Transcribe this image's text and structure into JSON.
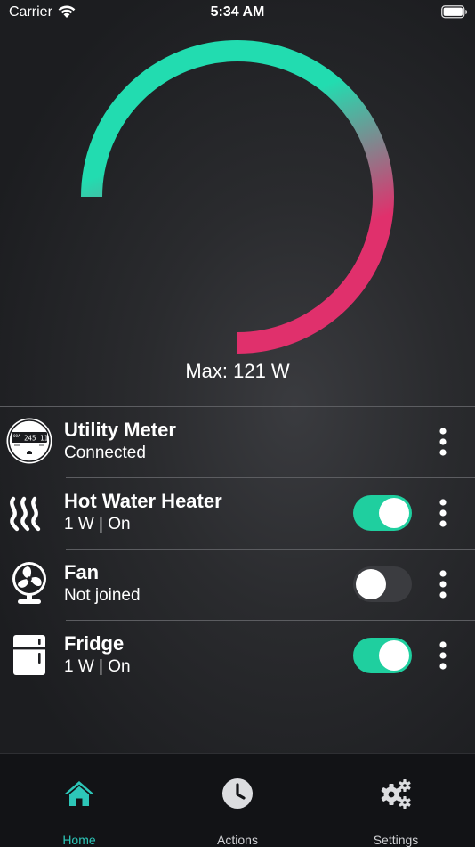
{
  "status_bar": {
    "carrier": "Carrier",
    "time": "5:34 AM"
  },
  "gauge": {
    "max_label": "Max: 121 W",
    "start_color": "#22dcb0",
    "end_color": "#e0306c"
  },
  "devices": [
    {
      "name": "Utility Meter",
      "status": "Connected",
      "icon": "utility-meter-icon",
      "has_toggle": false
    },
    {
      "name": "Hot Water Heater",
      "status": "1 W | On",
      "icon": "heat-waves-icon",
      "has_toggle": true,
      "toggle_on": true
    },
    {
      "name": "Fan",
      "status": "Not joined",
      "icon": "fan-icon",
      "has_toggle": true,
      "toggle_on": false
    },
    {
      "name": "Fridge",
      "status": "1 W | On",
      "icon": "fridge-icon",
      "has_toggle": true,
      "toggle_on": true
    }
  ],
  "meter_display": {
    "reading": "245 11",
    "small_text": "00A"
  },
  "tabs": [
    {
      "label": "Home",
      "icon": "home-icon",
      "active": true
    },
    {
      "label": "Actions",
      "icon": "clock-icon",
      "active": false
    },
    {
      "label": "Settings",
      "icon": "gears-icon",
      "active": false
    }
  ],
  "colors": {
    "accent": "#1fcf9f",
    "active_tab": "#2dc6b8",
    "gauge_pink": "#e0306c"
  }
}
